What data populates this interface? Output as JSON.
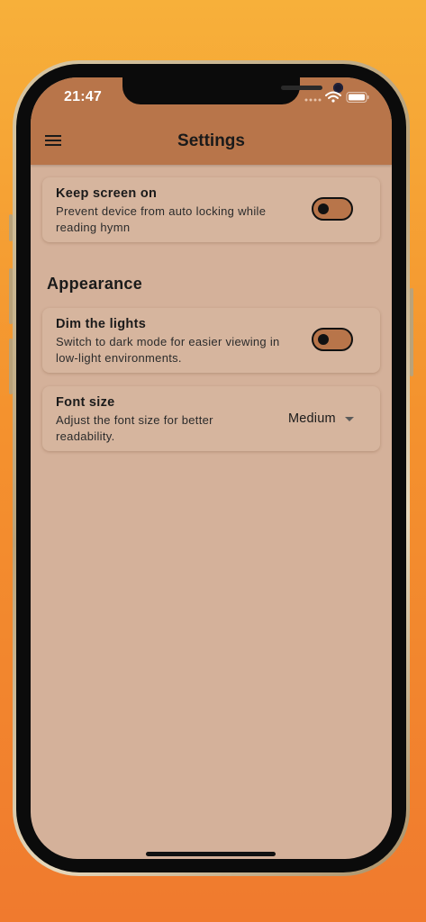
{
  "status_bar": {
    "time": "21:47"
  },
  "header": {
    "title": "Settings",
    "menu_icon": "hamburger-menu-icon"
  },
  "settings": {
    "keep_screen_on": {
      "title": "Keep screen on",
      "description": "Prevent device from auto locking while reading hymn",
      "enabled": false
    },
    "appearance": {
      "heading": "Appearance",
      "dim_lights": {
        "title": "Dim the lights",
        "description": "Switch to dark mode for easier viewing in low-light environments.",
        "enabled": false
      },
      "font_size": {
        "title": "Font size",
        "description": "Adjust the font size for better readability.",
        "selected": "Medium"
      }
    }
  },
  "colors": {
    "background_top": "#f7b03a",
    "background_bottom": "#f07a2e",
    "app_bar": "#b8754a",
    "screen_background": "#d4b19a",
    "card_background": "#d6b59e",
    "toggle_track": "#b8754a"
  }
}
